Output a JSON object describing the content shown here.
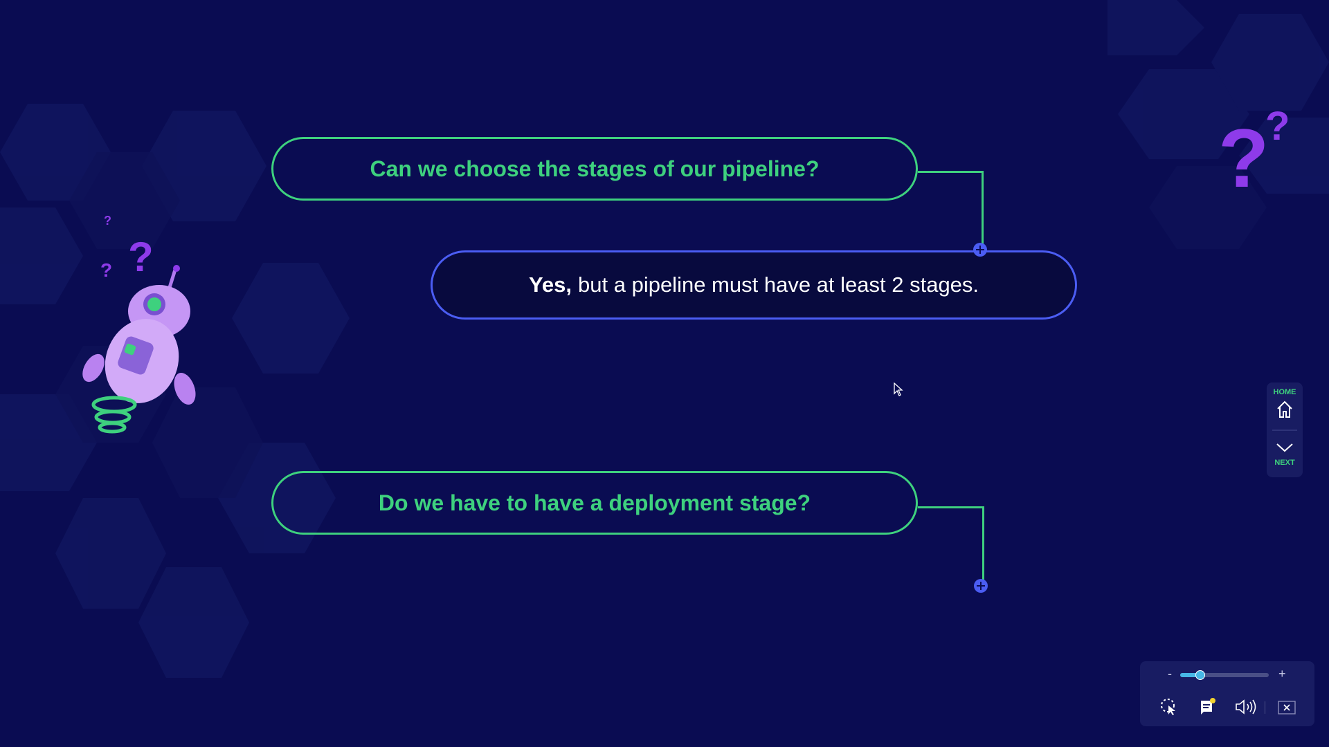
{
  "questions": [
    {
      "text": "Can we choose the stages of our pipeline?"
    },
    {
      "text": "Do we have to have a deployment stage?"
    }
  ],
  "answer": {
    "bold": "Yes,",
    "text": "but a pipeline must have at least 2 stages."
  },
  "nav": {
    "home_label": "HOME",
    "next_label": "NEXT"
  },
  "controls": {
    "zoom_minus": "-",
    "zoom_plus": "+",
    "zoom_level": 0.2
  },
  "icons": [
    "question-mark-icon",
    "home-icon",
    "chevron-down-icon",
    "plus-icon",
    "pointer-icon",
    "captions-icon",
    "volume-icon",
    "close-icon"
  ],
  "colors": {
    "background": "#0a0c52",
    "accent_green": "#3ed17e",
    "accent_blue": "#4b5df3",
    "purple": "#8e3bea"
  }
}
